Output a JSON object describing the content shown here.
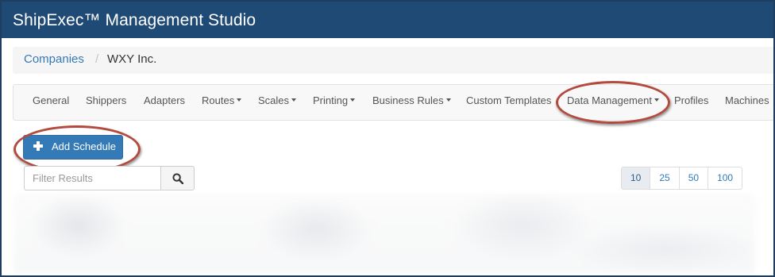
{
  "app": {
    "title": "ShipExec™ Management Studio"
  },
  "breadcrumb": {
    "parent": "Companies",
    "separator": "/",
    "current": "WXY Inc."
  },
  "nav": {
    "items": [
      {
        "label": "General",
        "dropdown": false
      },
      {
        "label": "Shippers",
        "dropdown": false
      },
      {
        "label": "Adapters",
        "dropdown": false
      },
      {
        "label": "Routes",
        "dropdown": true
      },
      {
        "label": "Scales",
        "dropdown": true
      },
      {
        "label": "Printing",
        "dropdown": true
      },
      {
        "label": "Business Rules",
        "dropdown": true
      },
      {
        "label": "Custom Templates",
        "dropdown": false
      },
      {
        "label": "Data Management",
        "dropdown": true
      },
      {
        "label": "Profiles",
        "dropdown": false
      },
      {
        "label": "Machines",
        "dropdown": false
      }
    ]
  },
  "actions": {
    "add_schedule_label": "Add Schedule",
    "add_icon": "plus-icon"
  },
  "filter": {
    "placeholder": "Filter Results",
    "value": "",
    "search_icon": "search-icon"
  },
  "pagination": {
    "sizes": [
      "10",
      "25",
      "50",
      "100"
    ],
    "selected": "10"
  },
  "colors": {
    "titlebar": "#1e4a75",
    "primary_button": "#337ab7",
    "link": "#337ab7",
    "annotation_oval": "#b24a3e"
  }
}
